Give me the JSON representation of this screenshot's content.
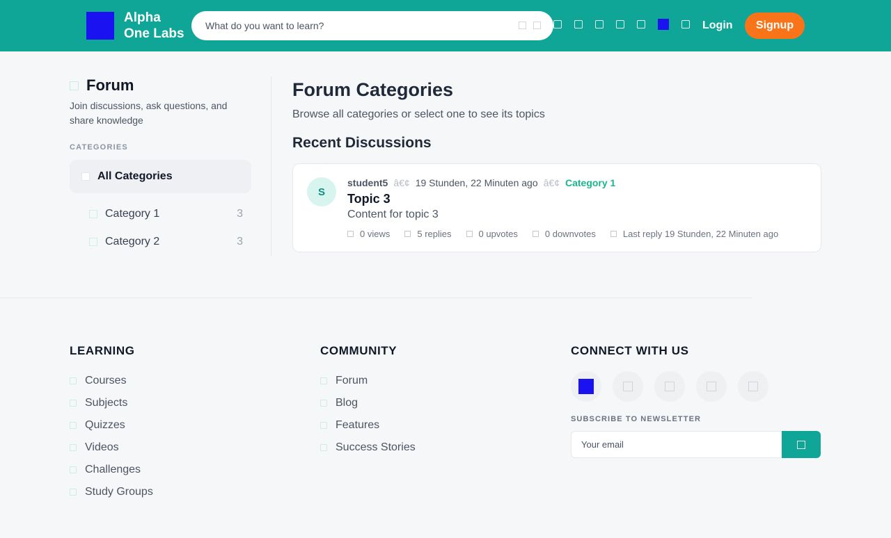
{
  "header": {
    "brand_line1": "Alpha",
    "brand_line2": "One Labs",
    "search_placeholder": "What do you want to learn?",
    "nav_icons": [
      "courses-icon",
      "quiz-icon",
      "video-icon",
      "groups-icon",
      "community-icon",
      "avatar-icon",
      "theme-icon"
    ],
    "login_label": "Login",
    "signup_label": "Signup",
    "colors": {
      "header_bg": "#0fa597",
      "signup_bg": "#f97418",
      "logo": "#1a12f0"
    }
  },
  "sidebar": {
    "title": "Forum",
    "description": "Join discussions, ask questions, and share knowledge",
    "categories_label": "CATEGORIES",
    "all_categories_label": "All Categories",
    "categories": [
      {
        "label": "Category 1",
        "count": "3"
      },
      {
        "label": "Category 2",
        "count": "3"
      }
    ]
  },
  "main": {
    "title": "Forum Categories",
    "subtitle": "Browse all categories or select one to see its topics",
    "recent_title": "Recent Discussions",
    "discussion": {
      "avatar_initial": "S",
      "author": "student5",
      "separator": "â€¢",
      "time": "19 Stunden, 22 Minuten ago",
      "category": "Category 1",
      "topic_title": "Topic 3",
      "content": "Content for topic 3",
      "stats": {
        "views": "0 views",
        "replies": "5 replies",
        "upvotes": "0 upvotes",
        "downvotes": "0 downvotes",
        "last_reply": "Last reply 19 Stunden, 22 Minuten ago"
      }
    }
  },
  "footer": {
    "learning": {
      "heading": "LEARNING",
      "links": [
        "Courses",
        "Subjects",
        "Quizzes",
        "Videos",
        "Challenges",
        "Study Groups"
      ]
    },
    "community": {
      "heading": "COMMUNITY",
      "links": [
        "Forum",
        "Blog",
        "Features",
        "Success Stories"
      ]
    },
    "connect": {
      "heading": "CONNECT WITH US",
      "socials": [
        "avatar-icon",
        "twitter-icon",
        "facebook-icon",
        "linkedin-icon",
        "github-icon"
      ],
      "newsletter_label": "SUBSCRIBE TO NEWSLETTER",
      "email_placeholder": "Your email",
      "submit_icon": "send-icon"
    }
  }
}
